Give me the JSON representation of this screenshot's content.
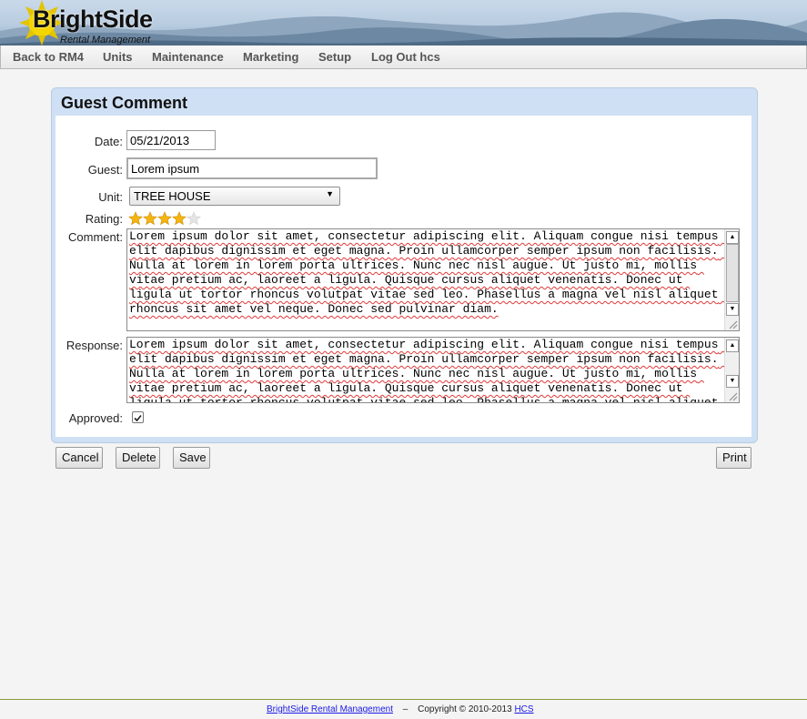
{
  "brand": {
    "name": "BrightSide",
    "tagline": "Rental Management"
  },
  "nav": {
    "items": [
      "Back to RM4",
      "Units",
      "Maintenance",
      "Marketing",
      "Setup",
      "Log Out hcs"
    ]
  },
  "form": {
    "title": "Guest Comment",
    "date_label": "Date:",
    "date_value": "05/21/2013",
    "guest_label": "Guest:",
    "guest_value": "Lorem ipsum",
    "unit_label": "Unit:",
    "unit_value": "TREE HOUSE",
    "rating_label": "Rating:",
    "rating_value": 4,
    "rating_max": 5,
    "comment_label": "Comment:",
    "comment_text": "Lorem ipsum dolor sit amet, consectetur adipiscing elit. Aliquam congue nisi tempus elit dapibus dignissim et eget magna. Proin ullamcorper semper ipsum non facilisis. Nulla at lorem in lorem porta ultrices. Nunc nec nisl augue. Ut justo mi, mollis vitae pretium ac, laoreet a ligula. Quisque cursus aliquet venenatis. Donec ut ligula ut tortor rhoncus volutpat vitae sed leo. Phasellus a magna vel nisl aliquet rhoncus sit amet vel neque. Donec sed pulvinar diam.",
    "response_label": "Response:",
    "response_text": "Lorem ipsum dolor sit amet, consectetur adipiscing elit. Aliquam congue nisi tempus elit dapibus dignissim et eget magna. Proin ullamcorper semper ipsum non facilisis. Nulla at lorem in lorem porta ultrices. Nunc nec nisl augue. Ut justo mi, mollis vitae pretium ac, laoreet a ligula. Quisque cursus aliquet venenatis. Donec ut ligula ut tortor rhoncus volutpat vitae sed leo. Phasellus a magna vel nisl aliquet rhoncus sit amet vel neque. Donec sed pulvinar diam.",
    "approved_label": "Approved:",
    "approved": true
  },
  "buttons": {
    "cancel": "Cancel",
    "delete": "Delete",
    "save": "Save",
    "print": "Print"
  },
  "footer": {
    "link_text": "BrightSide Rental Management",
    "separator": "–",
    "copyright": "Copyright © 2010-2013",
    "company": "HCS"
  },
  "colors": {
    "card_bg": "#cfe0f4",
    "star": "#f5b50f",
    "link": "#1a1ae6"
  }
}
